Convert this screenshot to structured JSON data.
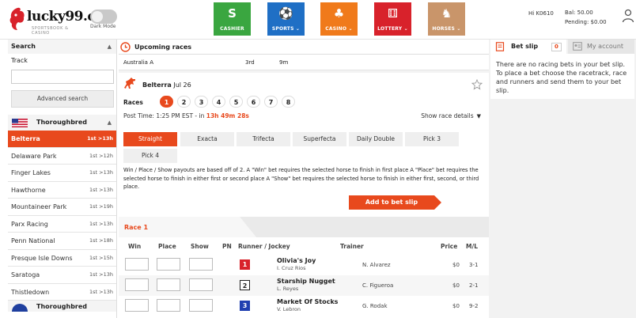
{
  "header": {
    "logo_text": "lucky99.eu",
    "logo_sub": "SPORTSBOOK & CASINO",
    "dark_mode_label": "Dark Mode",
    "nav": [
      {
        "label": "CASHIER",
        "icon": "cashier-icon",
        "glyph": "S",
        "color": "#3aa640"
      },
      {
        "label": "SPORTS",
        "icon": "sports-icon",
        "glyph": "⚽",
        "color": "#1f6fc5"
      },
      {
        "label": "CASINO",
        "icon": "casino-icon",
        "glyph": "♣",
        "color": "#f07a1b"
      },
      {
        "label": "LOTTERY",
        "icon": "lottery-icon",
        "glyph": "⚅",
        "color": "#d8222b"
      },
      {
        "label": "HORSES",
        "icon": "horses-icon",
        "glyph": "♞",
        "color": "#c9956a"
      }
    ],
    "greeting": "Hi",
    "user_id": "K0610",
    "balance_label": "Bal:",
    "balance": "50.00",
    "pending_label": "Pending:",
    "pending": "$0.00"
  },
  "sidebar": {
    "search_title": "Search",
    "track_label": "Track",
    "track_value": "",
    "advanced_search": "Advanced search",
    "category": "Thoroughbred",
    "tracks": [
      {
        "name": "Belterra",
        "time": "1st >13h",
        "active": true
      },
      {
        "name": "Delaware Park",
        "time": "1st >12h",
        "active": false
      },
      {
        "name": "Finger Lakes",
        "time": "1st >13h",
        "active": false
      },
      {
        "name": "Hawthorne",
        "time": "1st >13h",
        "active": false
      },
      {
        "name": "Mountaineer Park",
        "time": "1st >19h",
        "active": false
      },
      {
        "name": "Parx Racing",
        "time": "1st >13h",
        "active": false
      },
      {
        "name": "Penn National",
        "time": "1st >18h",
        "active": false
      },
      {
        "name": "Presque Isle Downs",
        "time": "1st >15h",
        "active": false
      },
      {
        "name": "Saratoga",
        "time": "1st >13h",
        "active": false
      },
      {
        "name": "Thistledown",
        "time": "1st >13h",
        "active": false
      }
    ],
    "category2": "Thoroughbred"
  },
  "upcoming": {
    "title": "Upcoming races",
    "rows": [
      {
        "track": "Australia A",
        "race": "3rd",
        "time": "9m"
      }
    ]
  },
  "race": {
    "venue": "Belterra",
    "date": "Jul 26",
    "races_label": "Races",
    "race_numbers": [
      "1",
      "2",
      "3",
      "4",
      "5",
      "6",
      "7",
      "8"
    ],
    "post_time_label": "Post Time: 1:25 PM EST - in",
    "countdown": "13h 49m 28s",
    "show_details": "Show race details",
    "bet_types": [
      "Straight",
      "Exacta",
      "Trifecta",
      "Superfecta",
      "Daily Double",
      "Pick 3",
      "Pick 4"
    ],
    "description": "Win / Place / Show payouts are based off of 2. A \"Win\" bet requires the selected horse to finish in first place A \"Place\" bet requires the selected horse to finish in either first or second place A \"Show\" bet requires the selected horse to finish in either first, second, or third place.",
    "add_to_slip": "Add to bet slip",
    "race_label": "Race 1",
    "columns": {
      "win": "Win",
      "place": "Place",
      "show": "Show",
      "pn": "PN",
      "runner": "Runner / Jockey",
      "trainer": "Trainer",
      "price": "Price",
      "ml": "M/L"
    },
    "runners": [
      {
        "pn": "1",
        "pn_bg": "#d8222b",
        "pn_fg": "#ffffff",
        "name": "Olivia's Joy",
        "jockey": "I. Cruz Rios",
        "trainer": "N. Alvarez",
        "price": "$0",
        "ml": "3-1"
      },
      {
        "pn": "2",
        "pn_bg": "#ffffff",
        "pn_fg": "#222222",
        "name": "Starship Nugget",
        "jockey": "L. Reyes",
        "trainer": "C. Figueroa",
        "price": "$0",
        "ml": "2-1"
      },
      {
        "pn": "3",
        "pn_bg": "#1f3fb0",
        "pn_fg": "#ffffff",
        "name": "Market Of Stocks",
        "jockey": "V. Lebron",
        "trainer": "G. Rodak",
        "price": "$0",
        "ml": "9-2"
      }
    ]
  },
  "betslip": {
    "tab_label": "Bet slip",
    "count": "0",
    "account_tab": "My account",
    "message": "There are no racing bets in your bet slip. To place a bet choose the racetrack, race and runners and send them to your bet slip."
  },
  "colors": {
    "accent": "#e8491d"
  }
}
